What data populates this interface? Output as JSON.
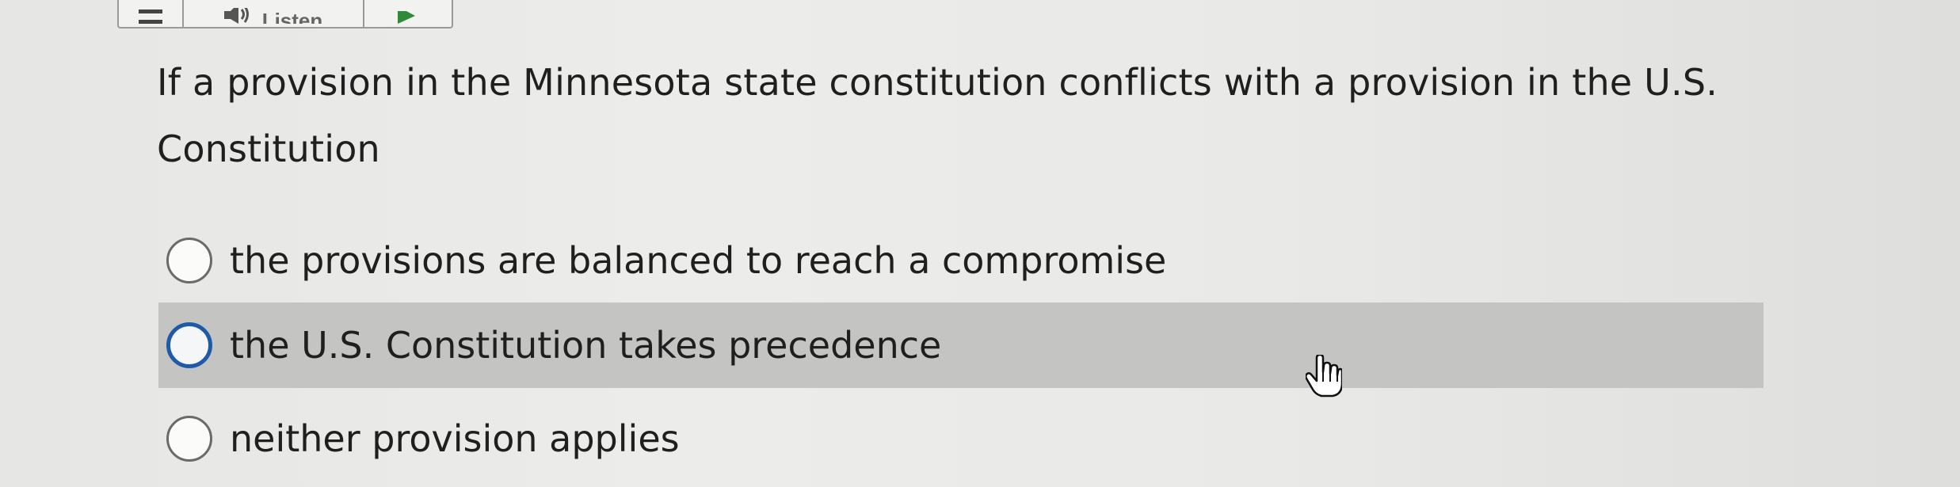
{
  "toolbar": {
    "menu_icon": "menu-icon",
    "listen_icon": "speaker-icon",
    "listen_label": "Listen",
    "play_icon": "play-icon",
    "play_color": "#2e8b3a"
  },
  "question": {
    "text": "If a provision in the Minnesota state constitution conflicts with a provision in the U.S. Constitution"
  },
  "options": [
    {
      "label": "the provisions are balanced to reach a compromise",
      "selected": false,
      "hovered": false
    },
    {
      "label": "the U.S. Constitution takes precedence",
      "selected": false,
      "hovered": true
    },
    {
      "label": "neither provision applies",
      "selected": false,
      "hovered": false
    }
  ],
  "cursor": {
    "icon": "hand-pointer-icon"
  },
  "colors": {
    "radio_hover_border": "#1f5aa8",
    "hover_row_bg": "#c4c4c2"
  }
}
